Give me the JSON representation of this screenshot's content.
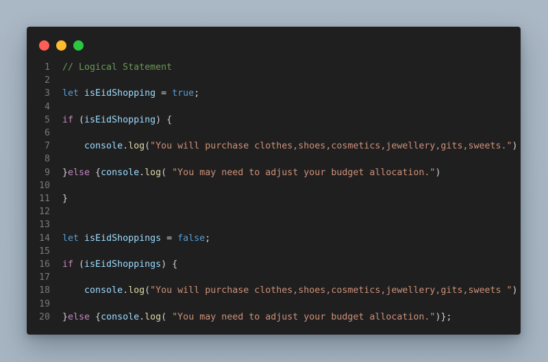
{
  "window": {
    "controls": [
      "close",
      "minimize",
      "maximize"
    ],
    "colors": {
      "close": "#ff5f57",
      "minimize": "#febc2e",
      "maximize": "#28c840",
      "background": "#1f1f1f"
    }
  },
  "code": {
    "lines": [
      {
        "num": "1",
        "tokens": [
          {
            "t": "// Logical Statement",
            "c": "comment"
          }
        ]
      },
      {
        "num": "2",
        "tokens": []
      },
      {
        "num": "3",
        "tokens": [
          {
            "t": "let",
            "c": "kw"
          },
          {
            "t": " ",
            "c": "plain"
          },
          {
            "t": "isEidShopping",
            "c": "var"
          },
          {
            "t": " = ",
            "c": "plain"
          },
          {
            "t": "true",
            "c": "kw"
          },
          {
            "t": ";",
            "c": "plain"
          }
        ]
      },
      {
        "num": "4",
        "tokens": []
      },
      {
        "num": "5",
        "tokens": [
          {
            "t": "if",
            "c": "ctrl"
          },
          {
            "t": " (",
            "c": "plain"
          },
          {
            "t": "isEidShopping",
            "c": "var"
          },
          {
            "t": ") {",
            "c": "plain"
          }
        ]
      },
      {
        "num": "6",
        "tokens": []
      },
      {
        "num": "7",
        "tokens": [
          {
            "t": "    ",
            "c": "plain"
          },
          {
            "t": "console",
            "c": "var"
          },
          {
            "t": ".",
            "c": "plain"
          },
          {
            "t": "log",
            "c": "fn"
          },
          {
            "t": "(",
            "c": "plain"
          },
          {
            "t": "\"You will purchase clothes,shoes,cosmetics,jewellery,gits,sweets.\"",
            "c": "str"
          },
          {
            "t": ")",
            "c": "plain"
          }
        ]
      },
      {
        "num": "8",
        "tokens": []
      },
      {
        "num": "9",
        "tokens": [
          {
            "t": "}",
            "c": "plain"
          },
          {
            "t": "else",
            "c": "ctrl"
          },
          {
            "t": " {",
            "c": "plain"
          },
          {
            "t": "console",
            "c": "var"
          },
          {
            "t": ".",
            "c": "plain"
          },
          {
            "t": "log",
            "c": "fn"
          },
          {
            "t": "( ",
            "c": "plain"
          },
          {
            "t": "\"You may need to adjust your budget allocation.\"",
            "c": "str"
          },
          {
            "t": ")",
            "c": "plain"
          }
        ]
      },
      {
        "num": "10",
        "tokens": []
      },
      {
        "num": "11",
        "tokens": [
          {
            "t": "}",
            "c": "plain"
          }
        ]
      },
      {
        "num": "12",
        "tokens": []
      },
      {
        "num": "13",
        "tokens": []
      },
      {
        "num": "14",
        "tokens": [
          {
            "t": "let",
            "c": "kw"
          },
          {
            "t": " ",
            "c": "plain"
          },
          {
            "t": "isEidShoppings",
            "c": "var"
          },
          {
            "t": " = ",
            "c": "plain"
          },
          {
            "t": "false",
            "c": "kw"
          },
          {
            "t": ";",
            "c": "plain"
          }
        ]
      },
      {
        "num": "15",
        "tokens": []
      },
      {
        "num": "16",
        "tokens": [
          {
            "t": "if",
            "c": "ctrl"
          },
          {
            "t": " (",
            "c": "plain"
          },
          {
            "t": "isEidShoppings",
            "c": "var"
          },
          {
            "t": ") {",
            "c": "plain"
          }
        ]
      },
      {
        "num": "17",
        "tokens": []
      },
      {
        "num": "18",
        "tokens": [
          {
            "t": "    ",
            "c": "plain"
          },
          {
            "t": "console",
            "c": "var"
          },
          {
            "t": ".",
            "c": "plain"
          },
          {
            "t": "log",
            "c": "fn"
          },
          {
            "t": "(",
            "c": "plain"
          },
          {
            "t": "\"You will purchase clothes,shoes,cosmetics,jewellery,gits,sweets \"",
            "c": "str"
          },
          {
            "t": ")",
            "c": "plain"
          }
        ]
      },
      {
        "num": "19",
        "tokens": []
      },
      {
        "num": "20",
        "tokens": [
          {
            "t": "}",
            "c": "plain"
          },
          {
            "t": "else",
            "c": "ctrl"
          },
          {
            "t": " {",
            "c": "plain"
          },
          {
            "t": "console",
            "c": "var"
          },
          {
            "t": ".",
            "c": "plain"
          },
          {
            "t": "log",
            "c": "fn"
          },
          {
            "t": "( ",
            "c": "plain"
          },
          {
            "t": "\"You may need to adjust your budget allocation.\"",
            "c": "str"
          },
          {
            "t": ")};",
            "c": "plain"
          }
        ]
      }
    ]
  }
}
